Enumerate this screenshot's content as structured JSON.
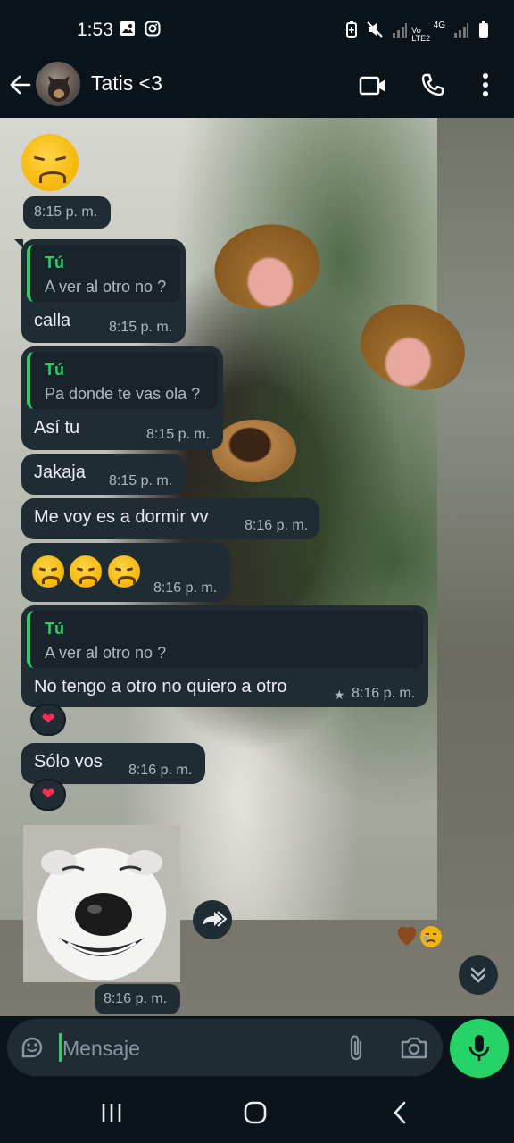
{
  "status_bar": {
    "time": "1:53",
    "network_label": "Vo LTE2",
    "network_gen": "4G"
  },
  "header": {
    "contact_name": "Tatis <3"
  },
  "messages": {
    "m0": {
      "time": "8:15 p. m."
    },
    "m1": {
      "quote_author": "Tú",
      "quote_text": "A ver al otro no ?",
      "text": "calla",
      "time": "8:15 p. m."
    },
    "m2": {
      "quote_author": "Tú",
      "quote_text": "Pa donde te vas ola ?",
      "text": "Así tu",
      "time": "8:15 p. m."
    },
    "m3": {
      "text": "Jakaja",
      "time": "8:15 p. m."
    },
    "m4": {
      "text": "Me voy es a dormir vv",
      "time": "8:16 p. m."
    },
    "m5": {
      "time": "8:16 p. m."
    },
    "m6": {
      "quote_author": "Tú",
      "quote_text": "A ver al otro no ?",
      "text": "No tengo a otro no quiero a otro",
      "time": "8:16 p. m.",
      "star": "★",
      "reaction": "❤"
    },
    "m7": {
      "text": "Sólo vos",
      "time": "8:16 p. m.",
      "reaction": "❤"
    },
    "m8": {
      "time": "8:16 p. m."
    }
  },
  "composer": {
    "placeholder": "Mensaje"
  },
  "colors": {
    "accent": "#25d366",
    "bubble": "#202c33",
    "background": "#0b141a"
  },
  "icons": [
    "back-arrow-icon",
    "video-call-icon",
    "phone-icon",
    "more-options-icon",
    "sticker-icon",
    "attach-icon",
    "camera-icon",
    "mic-icon",
    "forward-icon",
    "scroll-down-icon"
  ]
}
